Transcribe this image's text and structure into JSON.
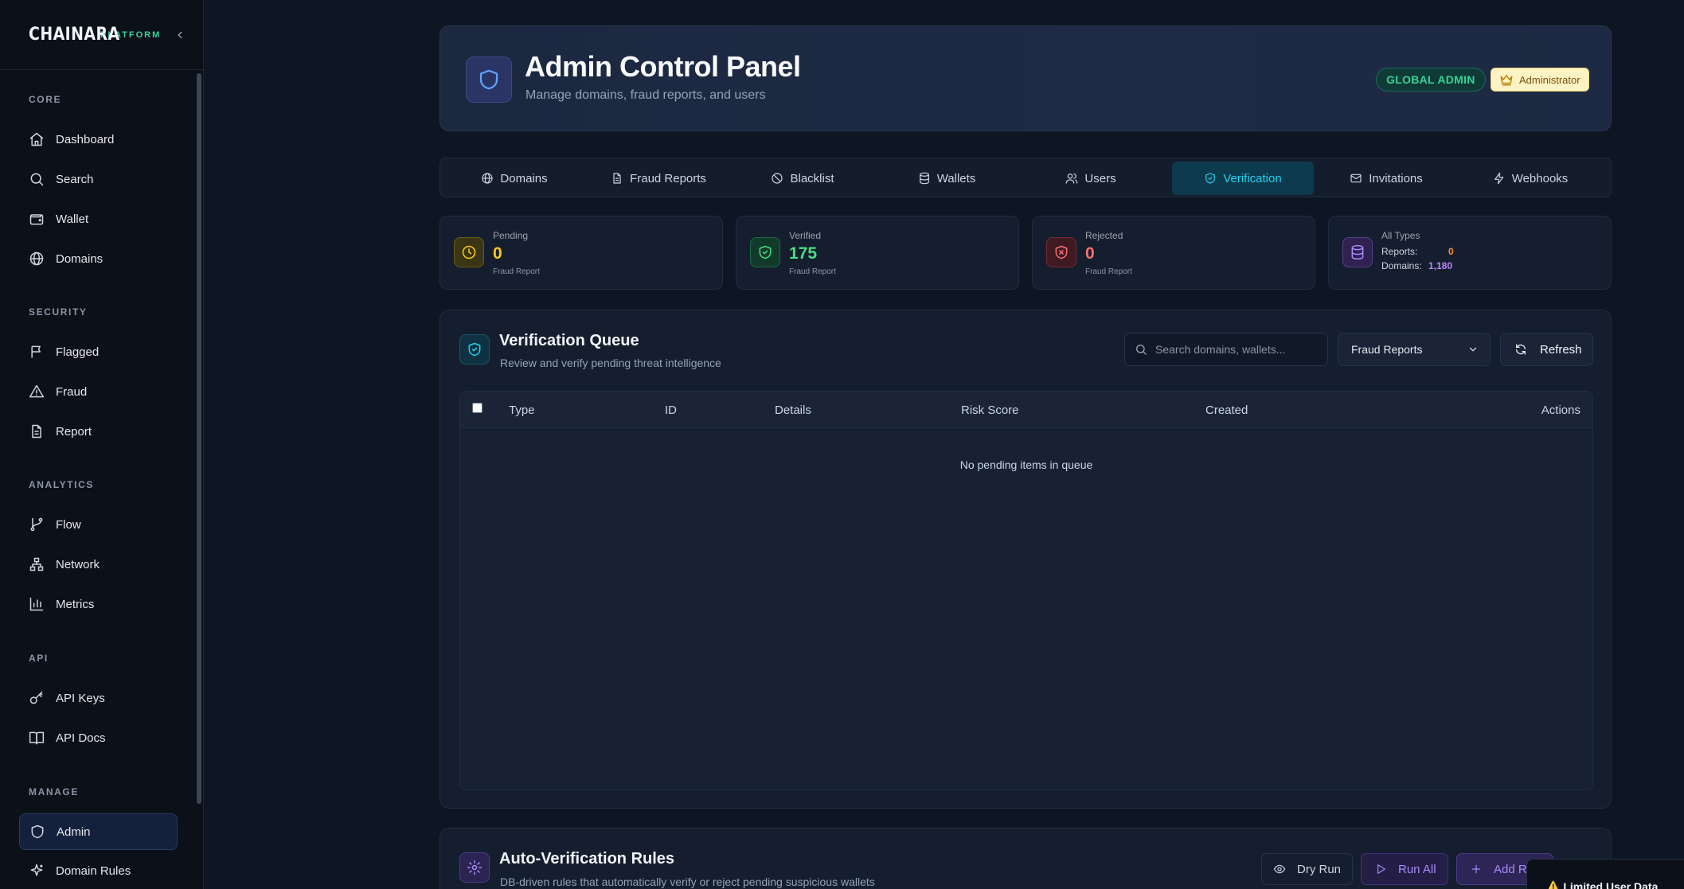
{
  "brand": {
    "name": "CHAINARA",
    "tag": "PLATFORM"
  },
  "sidebar": {
    "sections": [
      {
        "title": "CORE",
        "items": [
          {
            "label": "Dashboard",
            "icon": "home-icon"
          },
          {
            "label": "Search",
            "icon": "search-icon"
          },
          {
            "label": "Wallet",
            "icon": "wallet-icon"
          },
          {
            "label": "Domains",
            "icon": "globe-icon"
          }
        ]
      },
      {
        "title": "SECURITY",
        "items": [
          {
            "label": "Flagged",
            "icon": "flag-icon"
          },
          {
            "label": "Fraud",
            "icon": "warning-icon"
          },
          {
            "label": "Report",
            "icon": "document-icon"
          }
        ]
      },
      {
        "title": "ANALYTICS",
        "items": [
          {
            "label": "Flow",
            "icon": "git-branch-icon"
          },
          {
            "label": "Network",
            "icon": "network-icon"
          },
          {
            "label": "Metrics",
            "icon": "bar-chart-icon"
          }
        ]
      },
      {
        "title": "API",
        "items": [
          {
            "label": "API Keys",
            "icon": "key-icon"
          },
          {
            "label": "API Docs",
            "icon": "book-icon"
          }
        ]
      },
      {
        "title": "MANAGE",
        "items": [
          {
            "label": "Admin",
            "icon": "shield-icon",
            "active": true
          },
          {
            "label": "Domain Rules",
            "icon": "sparkle-icon"
          }
        ]
      }
    ]
  },
  "header": {
    "title": "Admin Control Panel",
    "subtitle": "Manage domains, fraud reports, and users",
    "role_badge": "GLOBAL ADMIN",
    "user_badge": "Administrator"
  },
  "tabs": [
    {
      "label": "Domains",
      "icon": "globe-icon"
    },
    {
      "label": "Fraud Reports",
      "icon": "document-icon"
    },
    {
      "label": "Blacklist",
      "icon": "ban-icon"
    },
    {
      "label": "Wallets",
      "icon": "database-icon"
    },
    {
      "label": "Users",
      "icon": "users-icon"
    },
    {
      "label": "Verification",
      "icon": "shield-check-icon",
      "active": true
    },
    {
      "label": "Invitations",
      "icon": "mail-icon"
    },
    {
      "label": "Webhooks",
      "icon": "zap-icon"
    }
  ],
  "stats": {
    "pending": {
      "label": "Pending",
      "value": "0",
      "foot": "Fraud Report",
      "color": "#facc15"
    },
    "verified": {
      "label": "Verified",
      "value": "175",
      "foot": "Fraud Report",
      "color": "#4ade80"
    },
    "rejected": {
      "label": "Rejected",
      "value": "0",
      "foot": "Fraud Report",
      "color": "#f87171"
    },
    "all_types": {
      "label": "All Types",
      "reports_label": "Reports:",
      "reports_value": "0",
      "domains_label": "Domains:",
      "domains_value": "1,180"
    }
  },
  "queue": {
    "title": "Verification Queue",
    "subtitle": "Review and verify pending threat intelligence",
    "search_placeholder": "Search domains, wallets...",
    "filter_value": "Fraud Reports",
    "refresh_label": "Refresh",
    "columns": [
      "Type",
      "ID",
      "Details",
      "Risk Score",
      "Created",
      "Actions"
    ],
    "empty_text": "No pending items in queue"
  },
  "rules": {
    "title": "Auto-Verification Rules",
    "subtitle": "DB-driven rules that automatically verify or reject pending suspicious wallets",
    "dry_run_label": "Dry Run",
    "run_all_label": "Run All",
    "add_rule_label": "Add Ru"
  },
  "toast": {
    "text": "⚠️ Limited User Data"
  },
  "colors": {
    "accent": "#22d3ee",
    "admin_active": "#14213d",
    "purple": "#a78bfa"
  }
}
